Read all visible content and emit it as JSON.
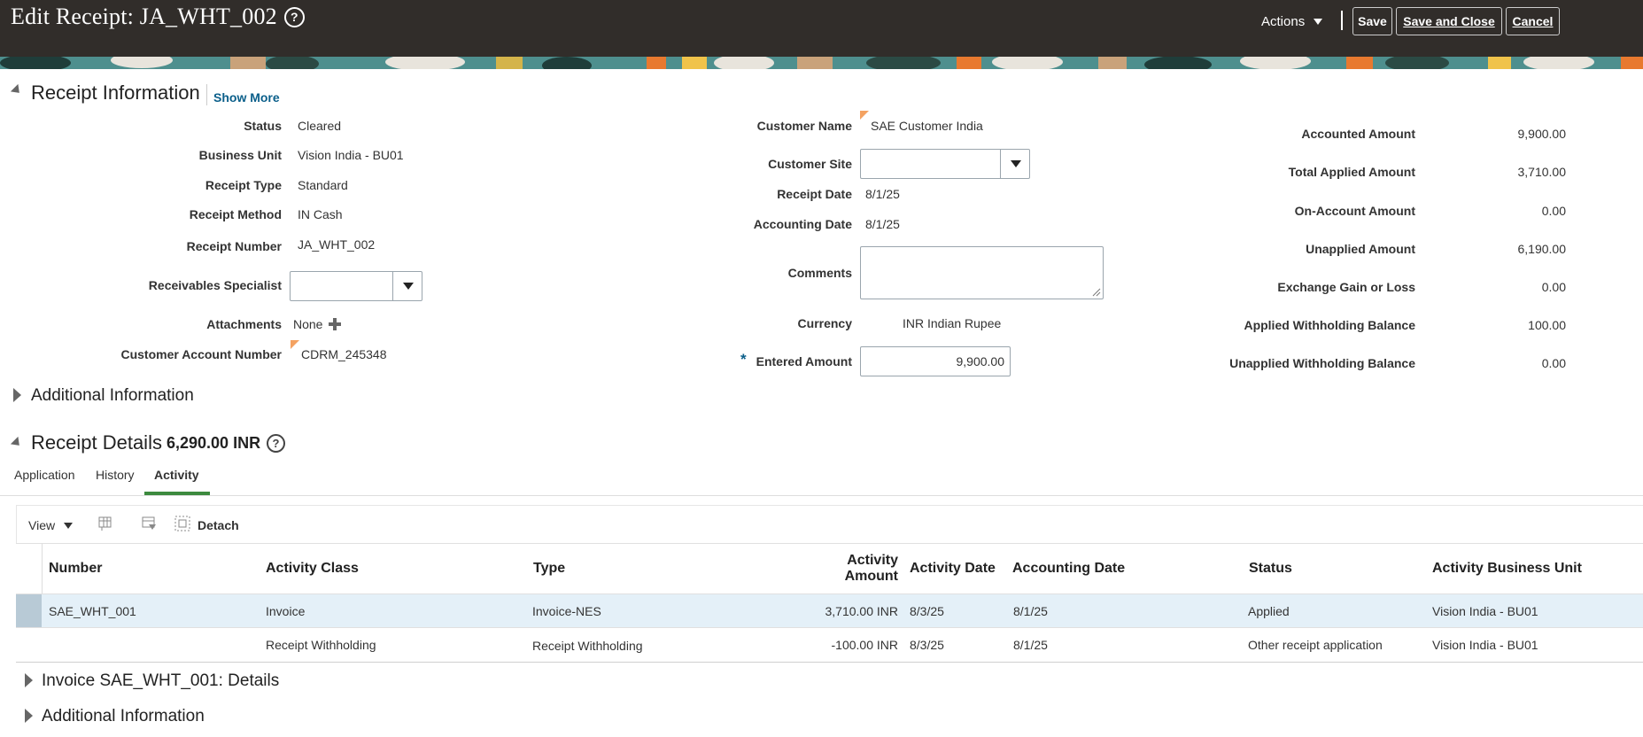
{
  "header": {
    "title": "Edit Receipt: JA_WHT_002",
    "help_glyph": "?",
    "actions_label": "Actions",
    "save_label": "Save",
    "save_close_label": "Save and Close",
    "cancel_label": "Cancel"
  },
  "receipt_info": {
    "heading": "Receipt Information",
    "show_more": "Show More",
    "left": {
      "status_label": "Status",
      "status": "Cleared",
      "bu_label": "Business Unit",
      "bu": "Vision India - BU01",
      "type_label": "Receipt Type",
      "type": "Standard",
      "method_label": "Receipt Method",
      "method": "IN Cash",
      "number_label": "Receipt Number",
      "number": "JA_WHT_002",
      "specialist_label": "Receivables Specialist",
      "specialist": "",
      "attachments_label": "Attachments",
      "attachments": "None",
      "account_label": "Customer Account Number",
      "account": "CDRM_245348"
    },
    "middle": {
      "customer_label": "Customer Name",
      "customer": "SAE Customer India",
      "site_label": "Customer Site",
      "site": "",
      "receipt_date_label": "Receipt Date",
      "receipt_date": "8/1/25",
      "acct_date_label": "Accounting Date",
      "acct_date": "8/1/25",
      "comments_label": "Comments",
      "comments": "",
      "currency_label": "Currency",
      "currency": "INR Indian Rupee",
      "required_mark": "*",
      "entered_label": "Entered Amount",
      "entered": "9,900.00"
    },
    "right": {
      "accounted_label": "Accounted Amount",
      "accounted": "9,900.00",
      "applied_label": "Total Applied Amount",
      "applied": "3,710.00",
      "onaccount_label": "On-Account Amount",
      "onaccount": "0.00",
      "unapplied_label": "Unapplied Amount",
      "unapplied": "6,190.00",
      "gain_label": "Exchange Gain or Loss",
      "gain": "0.00",
      "awb_label": "Applied Withholding Balance",
      "awb": "100.00",
      "uwb_label": "Unapplied Withholding Balance",
      "uwb": "0.00"
    }
  },
  "additional_info_label": "Additional Information",
  "receipt_details": {
    "heading": "Receipt Details",
    "amount": "6,290.00 INR",
    "tabs": [
      "Application",
      "History",
      "Activity"
    ],
    "toolbar": {
      "view_label": "View",
      "detach_label": "Detach"
    },
    "columns": {
      "number": "Number",
      "activity_class": "Activity Class",
      "type": "Type",
      "amount_line1": "Activity",
      "amount_line2": "Amount",
      "activity_date": "Activity Date",
      "accounting_date": "Accounting Date",
      "status": "Status",
      "bu": "Activity Business Unit"
    },
    "rows": [
      {
        "number": "SAE_WHT_001",
        "activity_class": "Invoice",
        "type": "Invoice-NES",
        "amount": "3,710.00 INR",
        "activity_date": "8/3/25",
        "accounting_date": "8/1/25",
        "status": "Applied",
        "bu": "Vision India - BU01"
      },
      {
        "number": "",
        "activity_class": "Receipt Withholding",
        "type": "Receipt Withholding",
        "amount": "-100.00 INR",
        "activity_date": "8/3/25",
        "accounting_date": "8/1/25",
        "status": "Other receipt application",
        "bu": "Vision India - BU01"
      }
    ]
  },
  "invoice_details_label": "Invoice SAE_WHT_001: Details",
  "additional_info_label_2": "Additional Information",
  "colors": {
    "header_bg": "#312d2a",
    "link": "#0b5f8a",
    "selected_row": "#e4f0f8",
    "tab_underline": "#3c8a3e"
  }
}
